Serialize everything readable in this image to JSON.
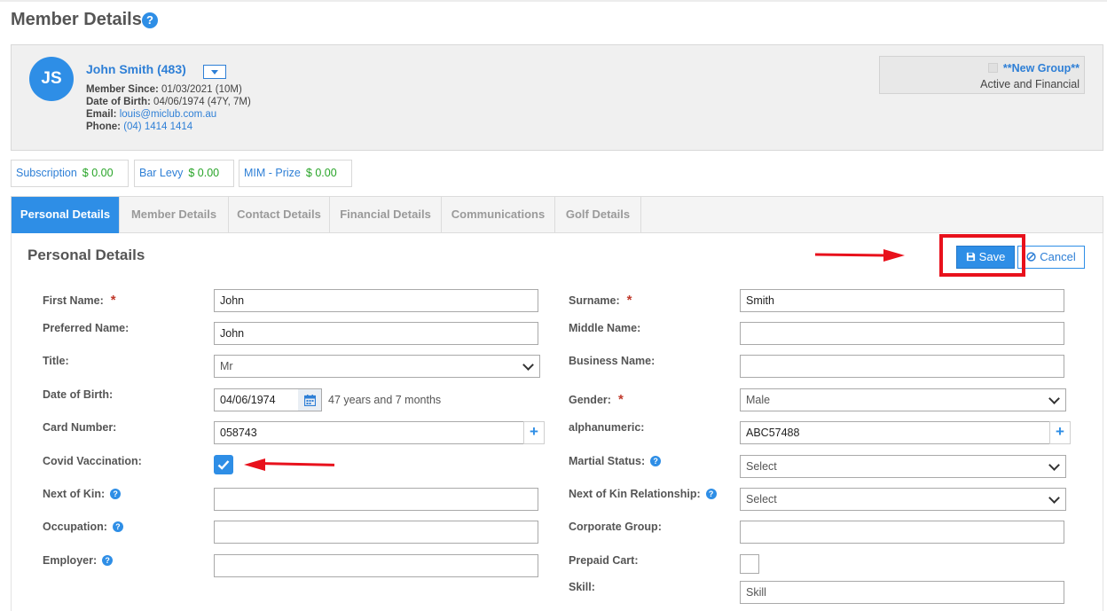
{
  "page": {
    "title": "Member Details"
  },
  "member": {
    "initials": "JS",
    "name": "John Smith (483)",
    "since_label": "Member Since:",
    "since_value": "01/03/2021 (10M)",
    "dob_label": "Date of Birth:",
    "dob_value": "04/06/1974 (47Y, 7M)",
    "email_label": "Email:",
    "email_value": "louis@miclub.com.au",
    "phone_label": "Phone:",
    "phone_value": "(04) 1414 1414"
  },
  "group": {
    "name": "**New Group**",
    "status": "Active and Financial"
  },
  "fees": [
    {
      "label": "Subscription",
      "amount": "$ 0.00"
    },
    {
      "label": "Bar Levy",
      "amount": "$ 0.00"
    },
    {
      "label": "MIM - Prize",
      "amount": "$ 0.00"
    }
  ],
  "tabs": [
    {
      "label": "Personal Details",
      "active": true
    },
    {
      "label": "Member Details",
      "active": false
    },
    {
      "label": "Contact Details",
      "active": false
    },
    {
      "label": "Financial Details",
      "active": false
    },
    {
      "label": "Communications",
      "active": false
    },
    {
      "label": "Golf Details",
      "active": false
    }
  ],
  "section": {
    "title": "Personal Details",
    "save": "Save",
    "cancel": "Cancel"
  },
  "form": {
    "first_name": {
      "label": "First Name:",
      "value": "John"
    },
    "preferred_name": {
      "label": "Preferred Name:",
      "value": "John"
    },
    "title": {
      "label": "Title:",
      "value": "Mr"
    },
    "dob": {
      "label": "Date of Birth:",
      "value": "04/06/1974",
      "age_text": "47 years and 7 months"
    },
    "card_number": {
      "label": "Card Number:",
      "value": "058743"
    },
    "covid": {
      "label": "Covid Vaccination:",
      "checked": true
    },
    "next_of_kin": {
      "label": "Next of Kin:",
      "value": ""
    },
    "occupation": {
      "label": "Occupation:",
      "value": ""
    },
    "employer": {
      "label": "Employer:",
      "value": ""
    },
    "surname": {
      "label": "Surname:",
      "value": "Smith"
    },
    "middle_name": {
      "label": "Middle Name:",
      "value": ""
    },
    "business_name": {
      "label": "Business Name:",
      "value": ""
    },
    "gender": {
      "label": "Gender:",
      "value": "Male"
    },
    "alphanumeric": {
      "label": "alphanumeric:",
      "value": "ABC57488"
    },
    "marital_status": {
      "label": "Martial Status:",
      "value": "Select"
    },
    "kin_relationship": {
      "label": "Next of Kin Relationship:",
      "value": "Select"
    },
    "corporate_group": {
      "label": "Corporate Group:",
      "value": ""
    },
    "prepaid_cart": {
      "label": "Prepaid Cart:",
      "checked": false
    },
    "skill": {
      "label": "Skill:",
      "placeholder": "Skill"
    }
  },
  "colors": {
    "accent": "#2e8ee6",
    "annotation": "#e8111c",
    "fee_amount": "#28a428"
  }
}
